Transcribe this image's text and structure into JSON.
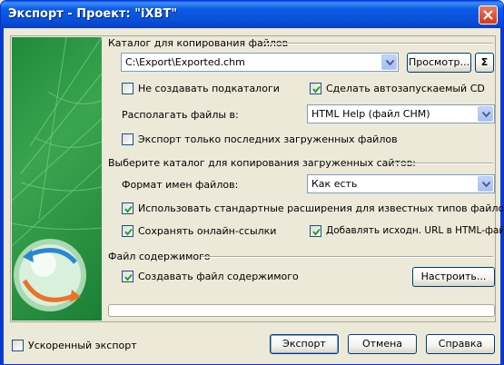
{
  "window": {
    "title": "Экспорт - Проект: \"iXBT\""
  },
  "catalog": {
    "group_label": "Каталог для копирования файлов",
    "path": "C:\\Export\\Exported.chm",
    "browse_label": "Просмотр...",
    "sigma_label": "Σ",
    "no_subdirs_label": "Не создавать подкаталоги",
    "no_subdirs_checked": false,
    "autorun_label": "Сделать автозапускаемый CD",
    "autorun_checked": true,
    "place_files_label": "Располагать файлы в:",
    "place_files_value": "HTML Help (файл CHM)",
    "only_last_label": "Экспорт только последних загруженных файлов",
    "only_last_checked": false
  },
  "sites": {
    "group_label": "Выберите каталог для копирования загруженных сайтов:",
    "filename_format_label": "Формат имен файлов:",
    "filename_format_value": "Как есть",
    "std_ext_label": "Использовать стандартные расширения для известных типов файлов",
    "std_ext_checked": true,
    "keep_links_label": "Сохранять онлайн-ссылки",
    "keep_links_checked": true,
    "add_url_label": "Добавлять исходн. URL в HTML-файл",
    "add_url_checked": true
  },
  "contents": {
    "group_label": "Файл содержимого",
    "create_label": "Создавать файл содержимого",
    "create_checked": true,
    "configure_label": "Настроить..."
  },
  "footer": {
    "fast_export_label": "Ускоренный экспорт",
    "fast_export_checked": false,
    "export_label": "Экспорт",
    "cancel_label": "Отмена",
    "help_label": "Справка"
  }
}
